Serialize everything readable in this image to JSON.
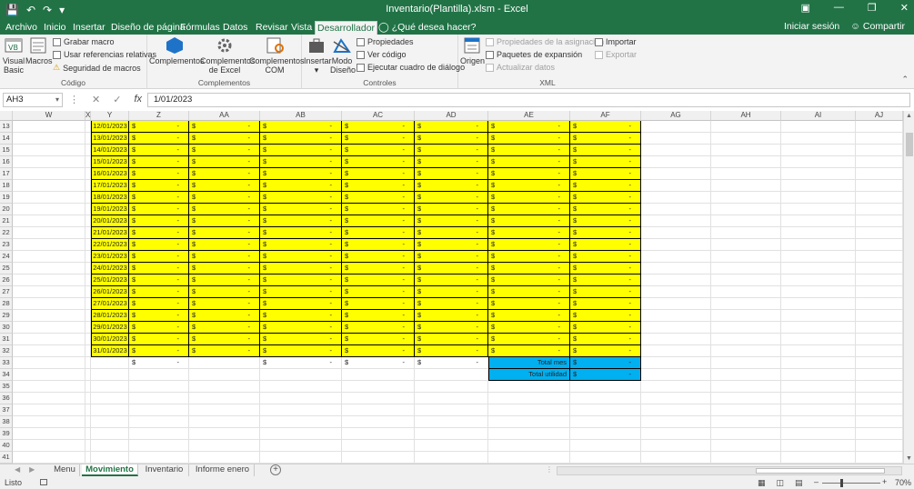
{
  "titlebar": {
    "title": "Inventario(Plantilla).xlsm - Excel",
    "save_icon": "save-icon",
    "undo_icon": "undo-icon",
    "redo_icon": "redo-icon"
  },
  "ribbon_tabs": [
    "Archivo",
    "Inicio",
    "Insertar",
    "Diseño de página",
    "Fórmulas",
    "Datos",
    "Revisar",
    "Vista",
    "Desarrollador"
  ],
  "active_tab": "Desarrollador",
  "tell_me": "¿Qué desea hacer?",
  "sign_in": "Iniciar sesión",
  "share": "Compartir",
  "ribbon": {
    "codigo": {
      "label": "Código",
      "visual_basic": "Visual Basic",
      "macros": "Macros",
      "grabar_macro": "Grabar macro",
      "usar_referencias": "Usar referencias relativas",
      "seguridad_macros": "Seguridad de macros"
    },
    "complementos": {
      "label": "Complementos",
      "complementos": "Complementos",
      "complementos_excel": "Complementos de Excel",
      "complementos_com": "Complementos COM"
    },
    "controles": {
      "label": "Controles",
      "insertar": "Insertar",
      "modo_diseno": "Modo Diseño",
      "propiedades": "Propiedades",
      "ver_codigo": "Ver código",
      "ejecutar_cuadro": "Ejecutar cuadro de diálogo"
    },
    "xml": {
      "label": "XML",
      "origen": "Origen",
      "propiedades_asignacion": "Propiedades de la asignación",
      "paquetes_expansion": "Paquetes de expansión",
      "actualizar_datos": "Actualizar datos",
      "importar": "Importar",
      "exportar": "Exportar"
    }
  },
  "formula_bar": {
    "name_box": "AH3",
    "fx": "fx",
    "formula": "1/01/2023"
  },
  "columns": [
    "W",
    "X",
    "Y",
    "Z",
    "AA",
    "AB",
    "AC",
    "AD",
    "AE",
    "AF",
    "AG",
    "AH",
    "AI",
    "AJ"
  ],
  "row_numbers": [
    "13",
    "14",
    "15",
    "16",
    "17",
    "18",
    "19",
    "20",
    "21",
    "22",
    "23",
    "24",
    "25",
    "26",
    "27",
    "28",
    "29",
    "30",
    "31",
    "32",
    "33",
    "34",
    "35",
    "36",
    "37",
    "38",
    "39",
    "40",
    "41"
  ],
  "dates": [
    "12/01/2023",
    "13/01/2023",
    "14/01/2023",
    "15/01/2023",
    "16/01/2023",
    "17/01/2023",
    "18/01/2023",
    "19/01/2023",
    "20/01/2023",
    "21/01/2023",
    "22/01/2023",
    "23/01/2023",
    "24/01/2023",
    "25/01/2023",
    "26/01/2023",
    "27/01/2023",
    "28/01/2023",
    "29/01/2023",
    "30/01/2023",
    "31/01/2023"
  ],
  "currency_symbol": "$",
  "empty_value": "-",
  "totals": {
    "total_mes": "Total mes",
    "total_utilidad": "Total utilidad"
  },
  "sheets": [
    "Menu",
    "Movimiento",
    "Inventario",
    "Informe enero"
  ],
  "active_sheet": "Movimiento",
  "status": {
    "ready": "Listo",
    "zoom": "70%"
  },
  "colors": {
    "excel_green": "#217346",
    "yellow_fill": "#ffff00",
    "blue_fill": "#00b0f0"
  }
}
